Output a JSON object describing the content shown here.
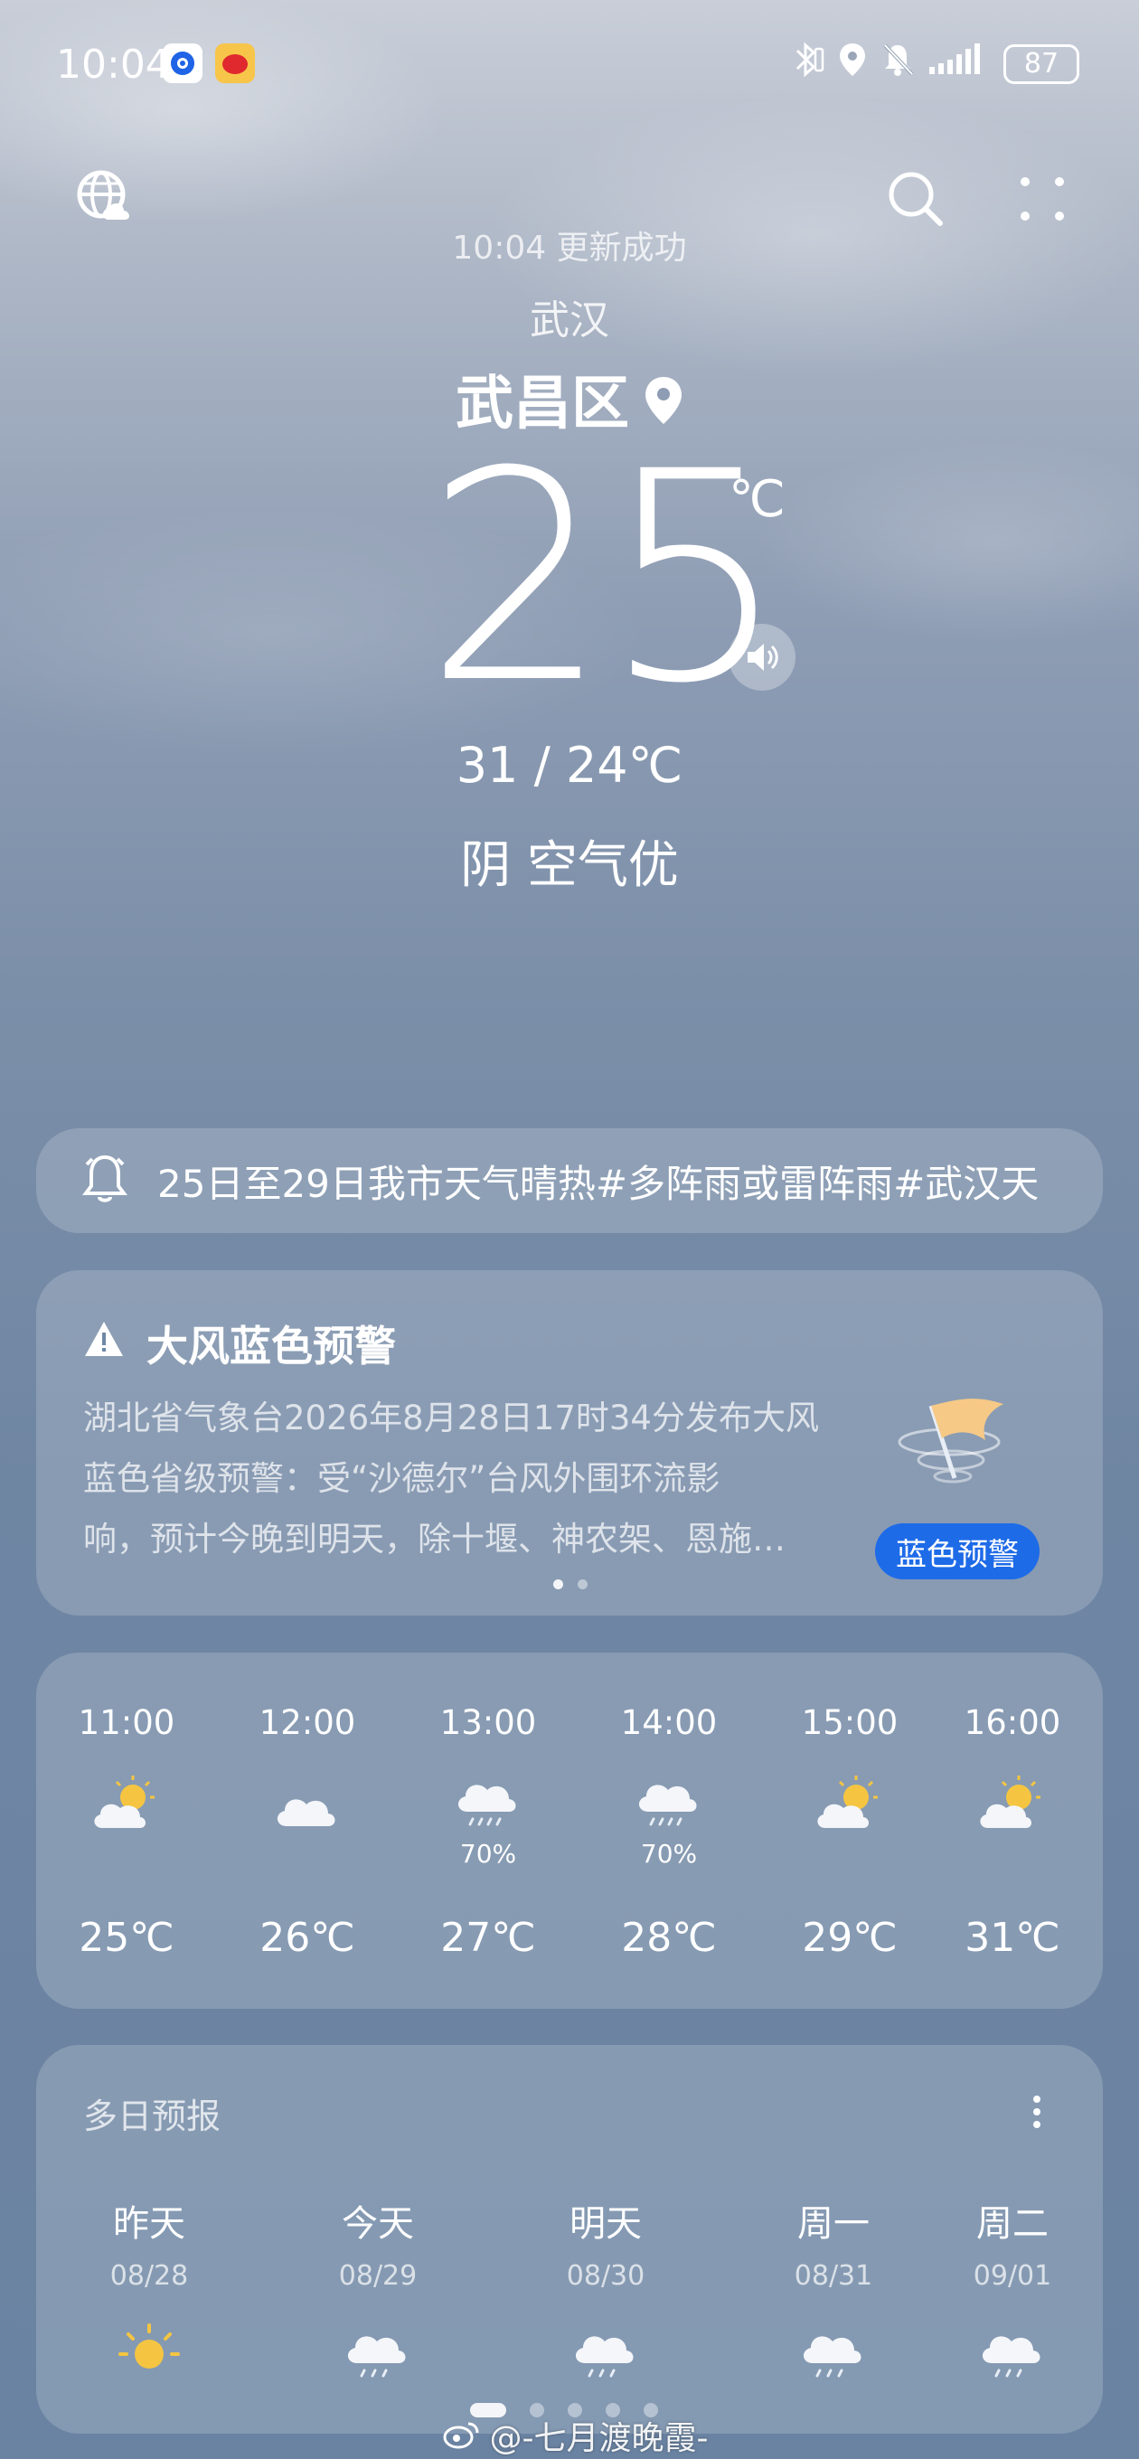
{
  "status_bar": {
    "time": "10:04",
    "battery": "87"
  },
  "header": {
    "update_text": "10:04 更新成功",
    "city": "武汉",
    "district": "武昌区"
  },
  "current": {
    "temperature": "25",
    "unit": "℃",
    "range": "31 / 24℃",
    "condition": "阴 空气优"
  },
  "notice": {
    "text": "25日至29日我市天气晴热#多阵雨或雷阵雨#武汉天"
  },
  "alert": {
    "title": "大风蓝色预警",
    "lines": [
      "湖北省气象台2026年8月28日17时34分发布大风",
      "蓝色省级预警：受“沙德尔”台风外围环流影",
      "响，预计今晚到明天，除十堰、神农架、恩施…"
    ],
    "badge": "蓝色预警",
    "badge_color": "#1e6be8",
    "pages": 2,
    "active_page": 1
  },
  "hourly": [
    {
      "time": "11:00",
      "icon": "sunny-cloudy-icon",
      "pop": "",
      "temp": "25℃"
    },
    {
      "time": "12:00",
      "icon": "cloudy-icon",
      "pop": "",
      "temp": "26℃"
    },
    {
      "time": "13:00",
      "icon": "rain-icon",
      "pop": "70%",
      "temp": "27℃"
    },
    {
      "time": "14:00",
      "icon": "rain-icon",
      "pop": "70%",
      "temp": "28℃"
    },
    {
      "time": "15:00",
      "icon": "sunny-cloudy-icon",
      "pop": "",
      "temp": "29℃"
    },
    {
      "time": "16:00",
      "icon": "sunny-cloudy-icon",
      "pop": "",
      "temp": "31℃"
    }
  ],
  "daily": {
    "title": "多日预报",
    "days": [
      {
        "name": "昨天",
        "date": "08/28",
        "icon": "sunny-icon"
      },
      {
        "name": "今天",
        "date": "08/29",
        "icon": "rain-icon"
      },
      {
        "name": "明天",
        "date": "08/30",
        "icon": "rain-icon"
      },
      {
        "name": "周一",
        "date": "08/31",
        "icon": "rain-icon"
      },
      {
        "name": "周二",
        "date": "09/01",
        "icon": "rain-icon"
      }
    ]
  },
  "watermark": "@-七月渡晚霞-"
}
